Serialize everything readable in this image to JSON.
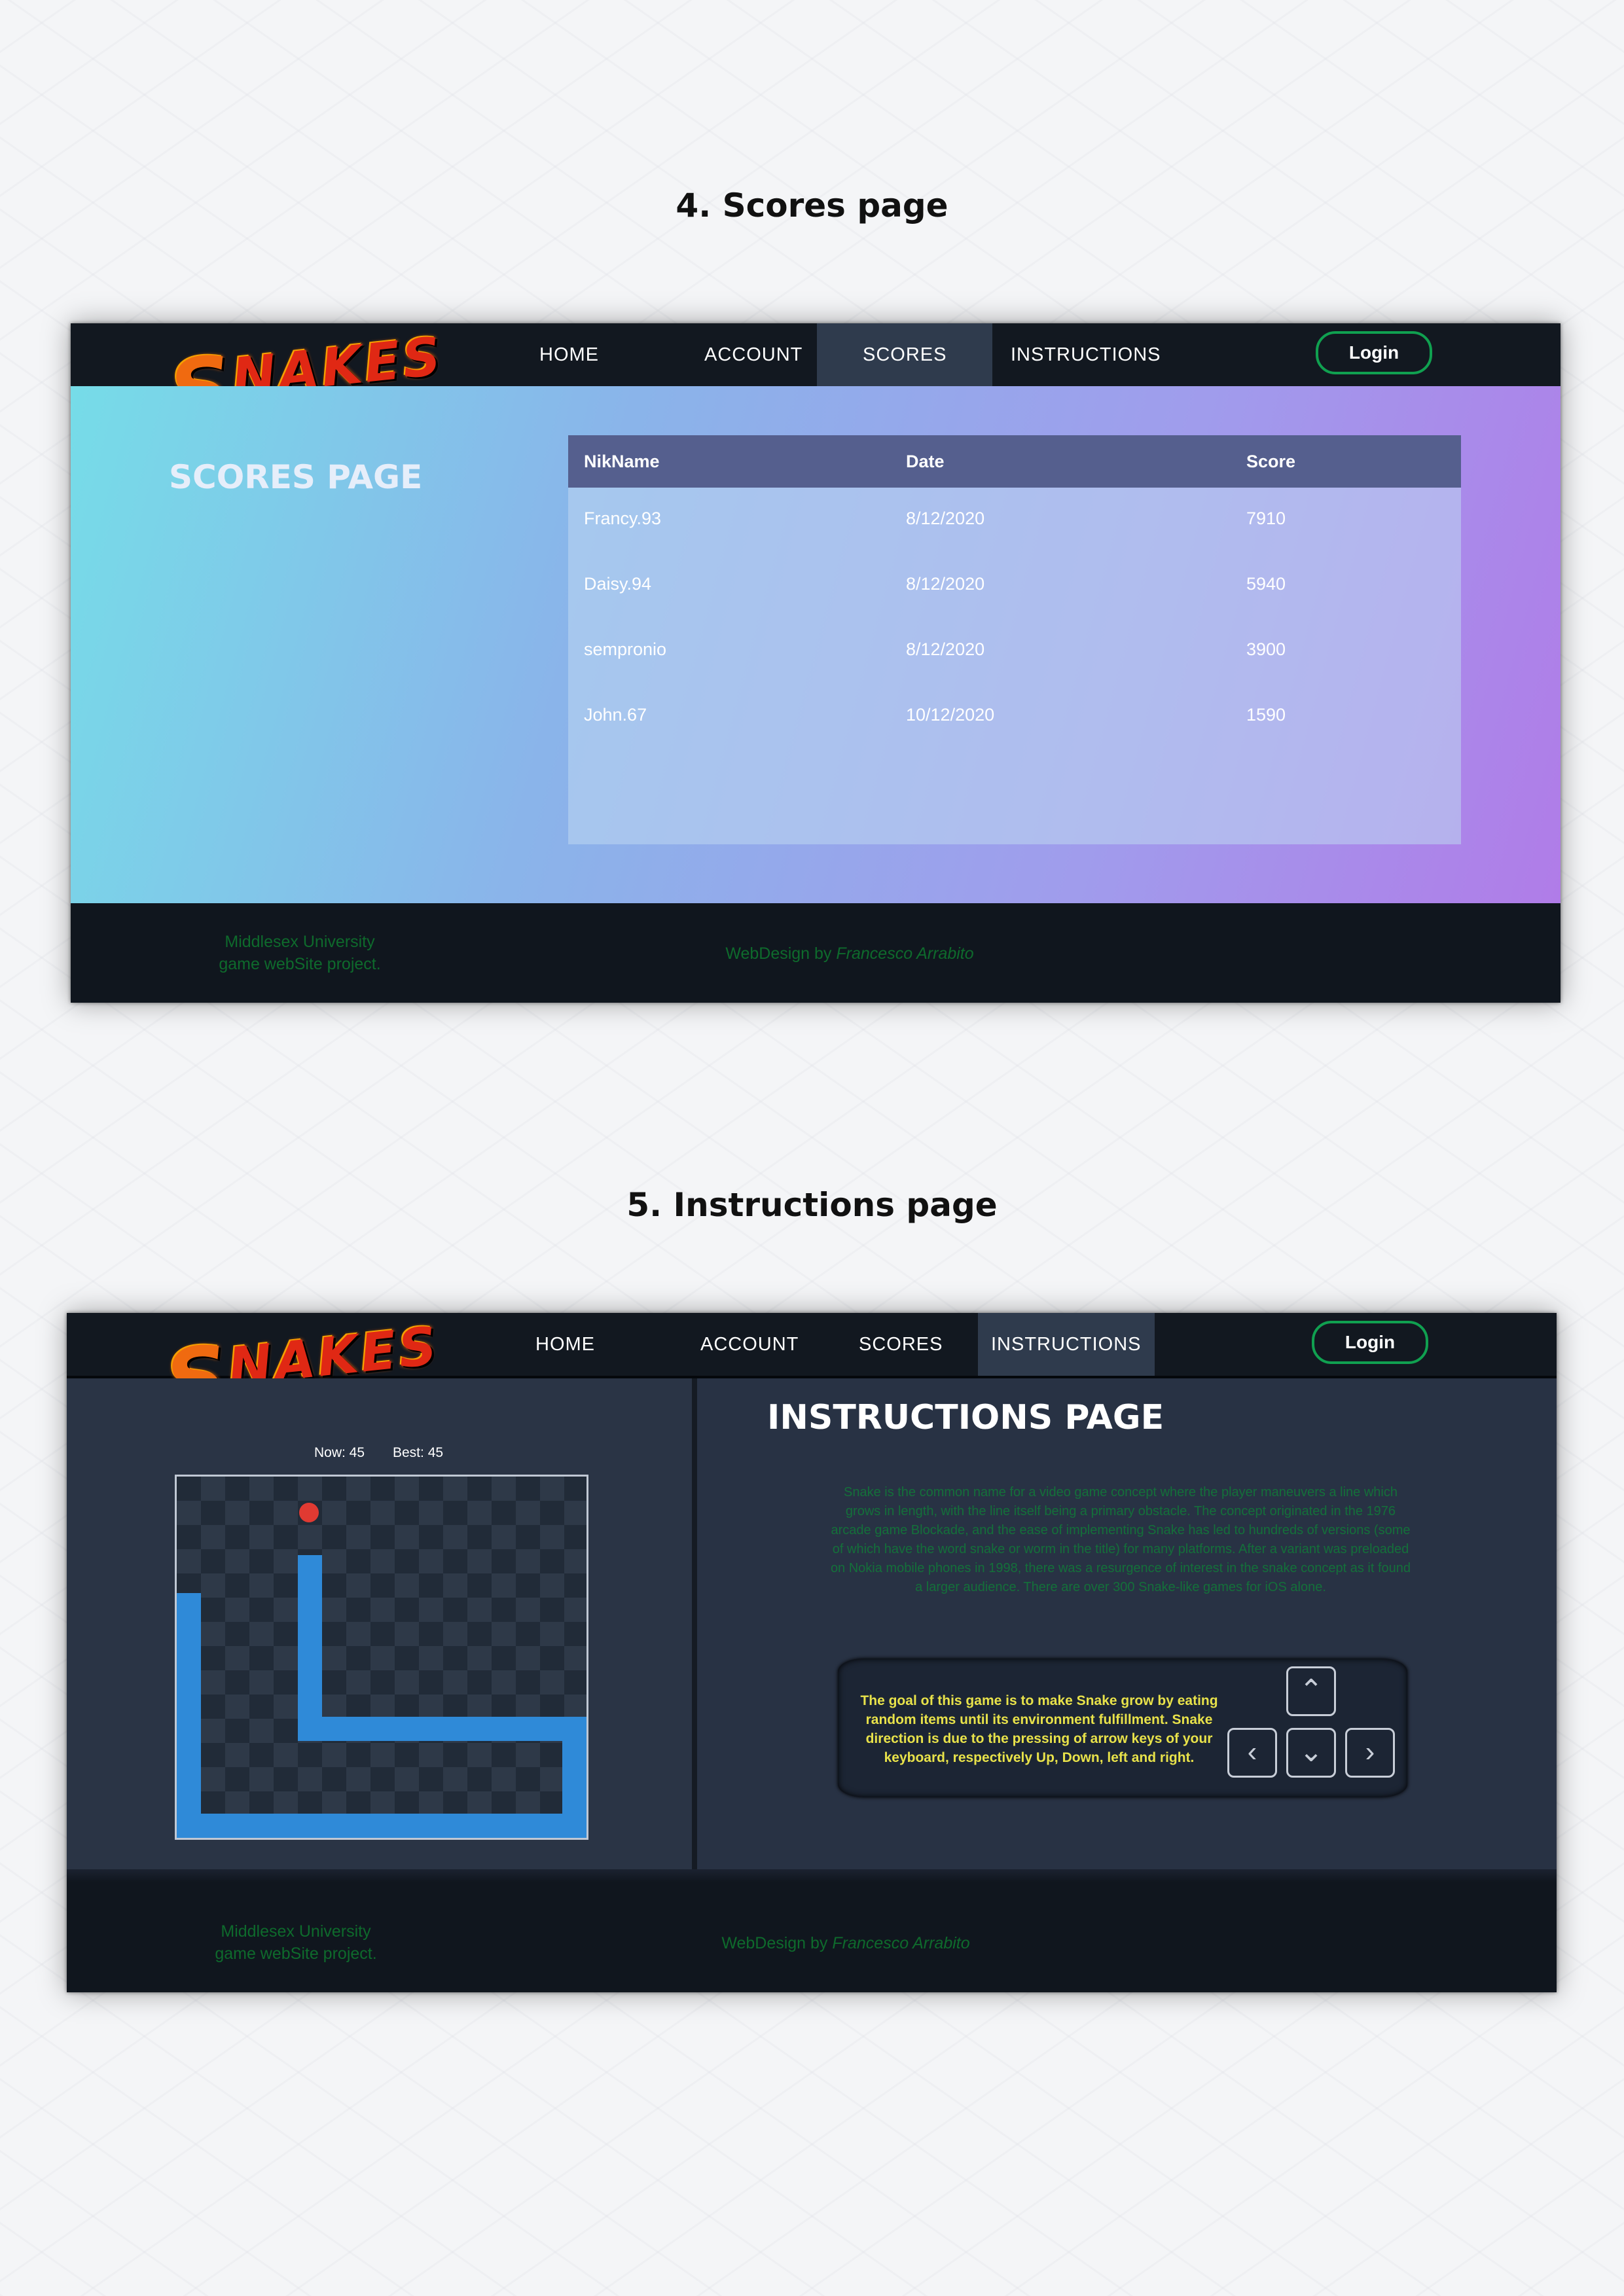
{
  "sections": {
    "scores_title": "4.  Scores page",
    "instructions_title": "5.  Instructions page"
  },
  "common": {
    "logo_text": "SNAKES",
    "logo_first": "S",
    "logo_rest": "NAKES",
    "nav": [
      "HOME",
      "ACCOUNT",
      "SCORES",
      "INSTRUCTIONS"
    ],
    "login": "Login",
    "footer_left_1": "Middlesex University",
    "footer_left_2": "game webSite project.",
    "footer_credit_prefix": "WebDesign by",
    "footer_credit_name": "Francesco Arrabito"
  },
  "scores_page": {
    "active_tab": "SCORES",
    "heading": "SCORES PAGE",
    "columns": [
      "NikName",
      "Date",
      "Score"
    ],
    "rows": [
      [
        "Francy.93",
        "8/12/2020",
        "7910"
      ],
      [
        "Daisy.94",
        "8/12/2020",
        "5940"
      ],
      [
        "sempronio",
        "8/12/2020",
        "3900"
      ],
      [
        "John.67",
        "10/12/2020",
        "1590"
      ]
    ]
  },
  "instructions_page": {
    "active_tab": "INSTRUCTIONS",
    "now_label": "Now: 45",
    "best_label": "Best: 45",
    "heading": "INSTRUCTIONS PAGE",
    "paragraph": "Snake is the common name for a video game concept where the player maneuvers a line which grows in length, with the line itself being a primary obstacle. The concept originated in the 1976 arcade game Blockade, and the ease of implementing Snake has led to hundreds of versions (some of which have the word snake or worm in the title) for many platforms. After a variant was preloaded on Nokia mobile phones in 1998, there was a resurgence of interest in the snake concept as it found a larger audience. There are over 300 Snake-like games for iOS alone.",
    "goal": "The goal of this game is to make Snake grow by eating random items until its environment fulfillment. Snake direction is due to the pressing of arrow keys of your keyboard, respectively Up, Down, left and right.",
    "keys": {
      "up": "⌃",
      "down": "⌄",
      "left": "‹",
      "right": "›"
    },
    "colors": {
      "snake": "#2f8ad8",
      "food": "#e03a32",
      "goal_text": "#e8e24a"
    }
  }
}
